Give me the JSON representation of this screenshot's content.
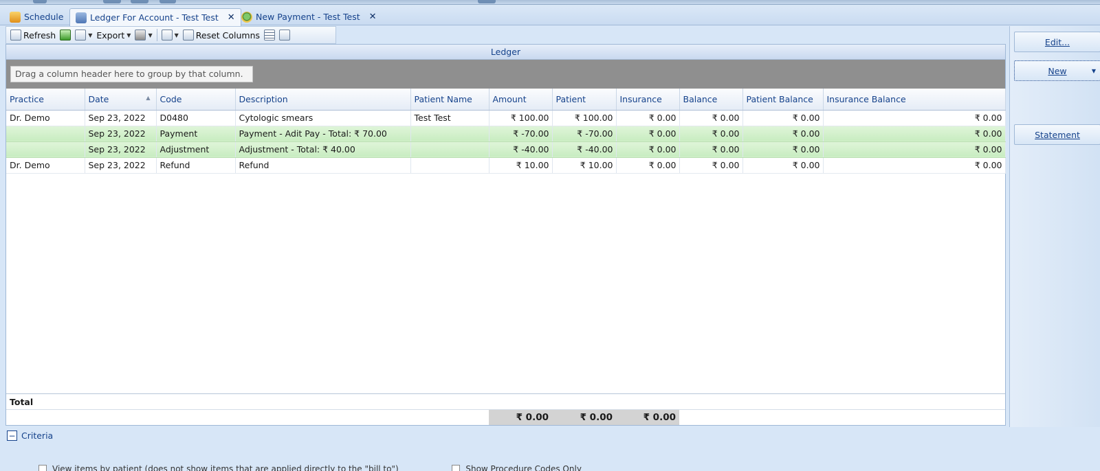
{
  "tabs": [
    {
      "label": "Schedule",
      "icon": "calendar-icon",
      "active": false
    },
    {
      "label": "Ledger For Account - Test Test",
      "icon": "ledger-icon",
      "active": true
    },
    {
      "label": "New Payment - Test Test",
      "icon": "payment-icon",
      "active": false
    }
  ],
  "toolbar": {
    "refresh_label": "Refresh",
    "export_label": "Export",
    "reset_columns_label": "Reset Columns"
  },
  "ledger": {
    "title": "Ledger",
    "group_hint": "Drag a column header here to group by that column.",
    "columns": [
      "Practice",
      "Date",
      "Code",
      "Description",
      "Patient Name",
      "Amount",
      "Patient",
      "Insurance",
      "Balance",
      "Patient Balance",
      "Insurance Balance"
    ],
    "rows": [
      {
        "practice": "Dr. Demo",
        "date": "Sep 23, 2022",
        "code": "D0480",
        "description": "Cytologic smears",
        "patient_name": "Test Test",
        "amount": "₹ 100.00",
        "patient": "₹ 100.00",
        "insurance": "₹ 0.00",
        "balance": "₹ 0.00",
        "patient_balance": "₹ 0.00",
        "insurance_balance": "₹ 0.00",
        "highlight": false
      },
      {
        "practice": "",
        "date": "Sep 23, 2022",
        "code": "Payment",
        "description": "Payment - Adit Pay - Total: ₹ 70.00",
        "patient_name": "",
        "amount": "₹ -70.00",
        "patient": "₹ -70.00",
        "insurance": "₹ 0.00",
        "balance": "₹ 0.00",
        "patient_balance": "₹ 0.00",
        "insurance_balance": "₹ 0.00",
        "highlight": true
      },
      {
        "practice": "",
        "date": "Sep 23, 2022",
        "code": "Adjustment",
        "description": "Adjustment - Total: ₹ 40.00",
        "patient_name": "",
        "amount": "₹ -40.00",
        "patient": "₹ -40.00",
        "insurance": "₹ 0.00",
        "balance": "₹ 0.00",
        "patient_balance": "₹ 0.00",
        "insurance_balance": "₹ 0.00",
        "highlight": true
      },
      {
        "practice": "Dr. Demo",
        "date": "Sep 23, 2022",
        "code": "Refund",
        "description": "Refund",
        "patient_name": "",
        "amount": "₹ 10.00",
        "patient": "₹ 10.00",
        "insurance": "₹ 0.00",
        "balance": "₹ 0.00",
        "patient_balance": "₹ 0.00",
        "insurance_balance": "₹ 0.00",
        "highlight": false
      }
    ],
    "total_label": "Total",
    "totals": {
      "amount": "₹ 0.00",
      "patient": "₹ 0.00",
      "insurance": "₹ 0.00"
    }
  },
  "side_buttons": {
    "edit": "Edit...",
    "new": "New",
    "statement": "Statement"
  },
  "criteria": {
    "label": "Criteria",
    "option_view_by_patient": "View items by patient (does not show items that are applied directly to the \"bill to\")",
    "option_show_procedure_codes": "Show Procedure Codes Only"
  }
}
